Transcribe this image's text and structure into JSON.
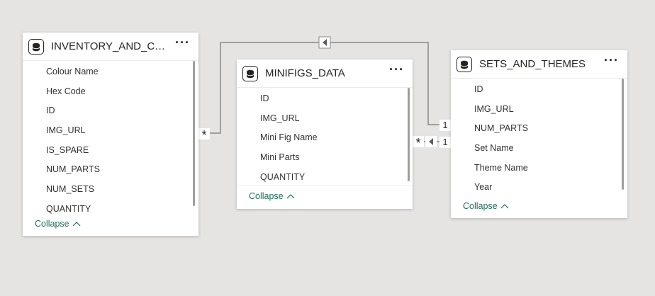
{
  "tables": [
    {
      "title": "INVENTORY_AND_COL...",
      "fields": [
        "Colour Name",
        "Hex Code",
        "ID",
        "IMG_URL",
        "IS_SPARE",
        "NUM_PARTS",
        "NUM_SETS",
        "QUANTITY"
      ],
      "collapse_label": "Collapse",
      "icon": "database-icon"
    },
    {
      "title": "MINIFIGS_DATA",
      "fields": [
        "ID",
        "IMG_URL",
        "Mini Fig Name",
        "Mini Parts",
        "QUANTITY"
      ],
      "collapse_label": "Collapse",
      "icon": "database-icon"
    },
    {
      "title": "SETS_AND_THEMES",
      "fields": [
        "ID",
        "IMG_URL",
        "NUM_PARTS",
        "Set Name",
        "Theme Name",
        "Year"
      ],
      "collapse_label": "Collapse",
      "icon": "database-icon"
    }
  ],
  "relationships": [
    {
      "from_cardinality": "*",
      "to_cardinality": "1",
      "direction": "left-arrow"
    },
    {
      "from_cardinality": "*",
      "to_cardinality": "1",
      "direction": "left-arrow"
    }
  ],
  "more_label": "···",
  "colors": {
    "canvas": "#e5e4e3",
    "line": "#808080",
    "collapse": "#1e6e5a"
  }
}
